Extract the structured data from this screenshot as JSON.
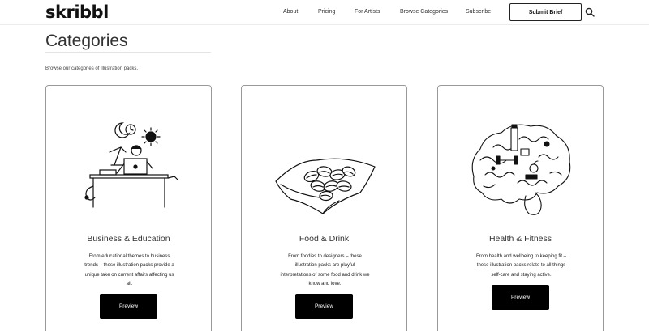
{
  "header": {
    "logo": "skribbl",
    "nav": [
      "About",
      "Pricing",
      "For Artists",
      "Browse Categories",
      "Subscribe"
    ],
    "submit_brief": "Submit Brief",
    "search_icon": "search-icon"
  },
  "page": {
    "title": "Categories",
    "intro": "Browse our categories of illustration packs."
  },
  "cards": [
    {
      "title": "Business & Education",
      "description": "From educational themes to business trends – these illustration packs provide a unique take on current affairs affecting us all.",
      "button": "Preview",
      "illustration": "business-education-illustration"
    },
    {
      "title": "Food & Drink",
      "description": "From foodies to designers – these illustration packs are playful interpretations of some food and drink we know and love.",
      "button": "Preview",
      "illustration": "food-drink-illustration"
    },
    {
      "title": "Health & Fitness",
      "description": "From health and wellbeing to keeping fit – these illustration packs relate to all things self-care and staying active.",
      "button": "Preview",
      "illustration": "health-fitness-illustration"
    }
  ],
  "colors": {
    "text": "#222222",
    "button_bg": "#000000",
    "button_text": "#ffffff",
    "card_border": "#999999"
  }
}
